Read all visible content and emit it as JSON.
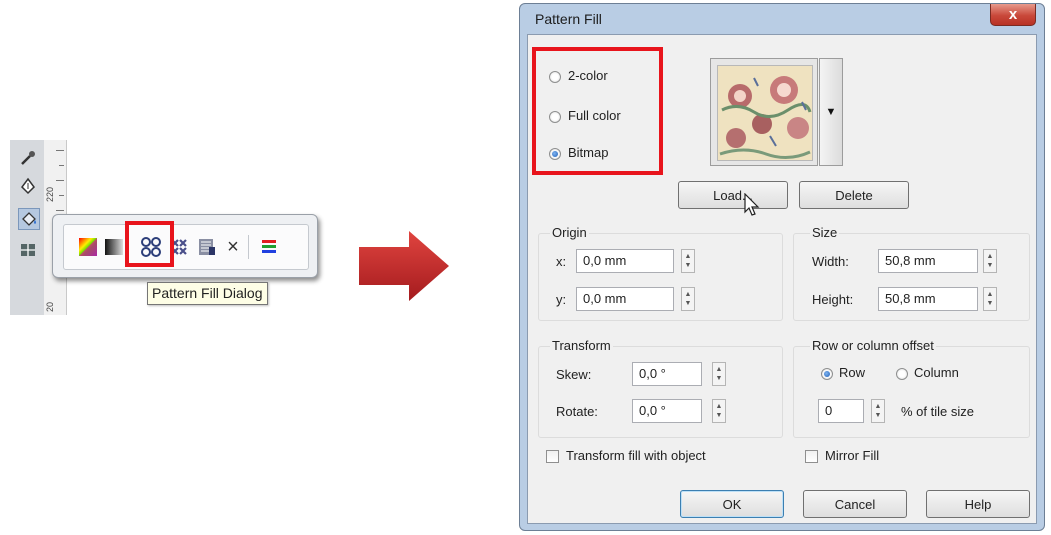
{
  "toolbar": {
    "ruler_number": "220",
    "ruler_number2": "20",
    "tooltip": "Pattern Fill Dialog",
    "flyout_icons": [
      "uniform-fill-icon",
      "fountain-fill-icon",
      "pattern-fill-icon",
      "texture-fill-icon",
      "postscript-fill-icon",
      "no-fill-icon",
      "color-docker-icon"
    ],
    "close_glyph": "×"
  },
  "dialog": {
    "title": "Pattern Fill",
    "close_glyph": "x",
    "pattern_type": {
      "options": [
        "2-color",
        "Full color",
        "Bitmap"
      ],
      "selected": "Bitmap"
    },
    "preview_dropdown_glyph": "▼",
    "load_label": "Load...",
    "delete_label": "Delete",
    "origin": {
      "label": "Origin",
      "x_label": "x:",
      "x_value": "0,0 mm",
      "y_label": "y:",
      "y_value": "0,0 mm"
    },
    "size": {
      "label": "Size",
      "width_label": "Width:",
      "width_value": "50,8 mm",
      "height_label": "Height:",
      "height_value": "50,8 mm"
    },
    "transform": {
      "label": "Transform",
      "skew_label": "Skew:",
      "skew_value": "0,0 °",
      "rotate_label": "Rotate:",
      "rotate_value": "0,0 °"
    },
    "offset": {
      "label": "Row or column offset",
      "row_label": "Row",
      "column_label": "Column",
      "selected": "Row",
      "value": "0",
      "suffix": "% of tile size"
    },
    "transform_fill_label": "Transform fill with object",
    "mirror_fill_label": "Mirror Fill",
    "ok_label": "OK",
    "cancel_label": "Cancel",
    "help_label": "Help"
  },
  "colors": {
    "highlight_red": "#e8141c",
    "arrow_red": "#c0262a",
    "dialog_frame": "#b9cde4"
  }
}
